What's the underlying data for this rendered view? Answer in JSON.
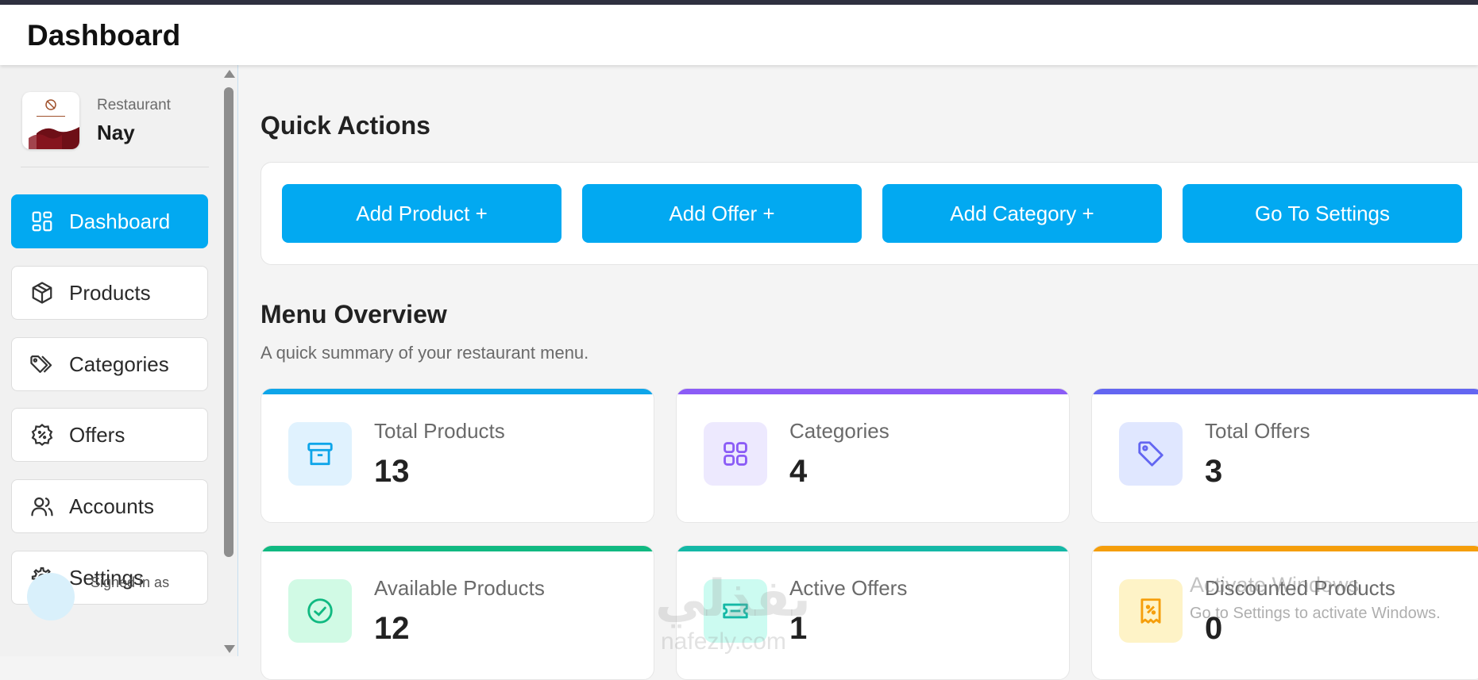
{
  "header": {
    "title": "Dashboard"
  },
  "sidebar": {
    "brand": {
      "type": "Restaurant",
      "name": "Nay"
    },
    "items": [
      {
        "label": "Dashboard",
        "icon": "dashboard-grid-icon",
        "active": true
      },
      {
        "label": "Products",
        "icon": "box-icon",
        "active": false
      },
      {
        "label": "Categories",
        "icon": "tags-icon",
        "active": false
      },
      {
        "label": "Offers",
        "icon": "discount-badge-icon",
        "active": false
      },
      {
        "label": "Accounts",
        "icon": "users-icon",
        "active": false
      },
      {
        "label": "Settings",
        "icon": "gear-icon",
        "active": false
      }
    ],
    "signed_in": "Signed in as"
  },
  "quick_actions": {
    "title": "Quick Actions",
    "buttons": [
      "Add Product +",
      "Add Offer +",
      "Add Category +",
      "Go To Settings"
    ]
  },
  "menu_overview": {
    "title": "Menu Overview",
    "subtitle": "A quick summary of your restaurant menu.",
    "cards": [
      {
        "label": "Total Products",
        "value": "13",
        "accent": "#0ea5e9",
        "icon": "archive-box-icon"
      },
      {
        "label": "Categories",
        "value": "4",
        "accent": "#8b5cf6",
        "icon": "grid-icon"
      },
      {
        "label": "Total Offers",
        "value": "3",
        "accent": "#6366f1",
        "icon": "tag-icon"
      },
      {
        "label": "Available Products",
        "value": "12",
        "accent": "#10b981",
        "icon": "check-circle-icon"
      },
      {
        "label": "Active Offers",
        "value": "1",
        "accent": "#14b8a6",
        "icon": "ticket-icon"
      },
      {
        "label": "Discounted Products",
        "value": "0",
        "accent": "#f59e0b",
        "icon": "receipt-percent-icon"
      }
    ]
  },
  "watermark": {
    "arabic": "نفذلي",
    "latin": "nafezly.com"
  },
  "os_notice": {
    "title": "Activate Windows",
    "subtitle": "Go to Settings to activate Windows."
  },
  "colors": {
    "primary": "#02a9f1",
    "background": "#f4f4f4"
  }
}
